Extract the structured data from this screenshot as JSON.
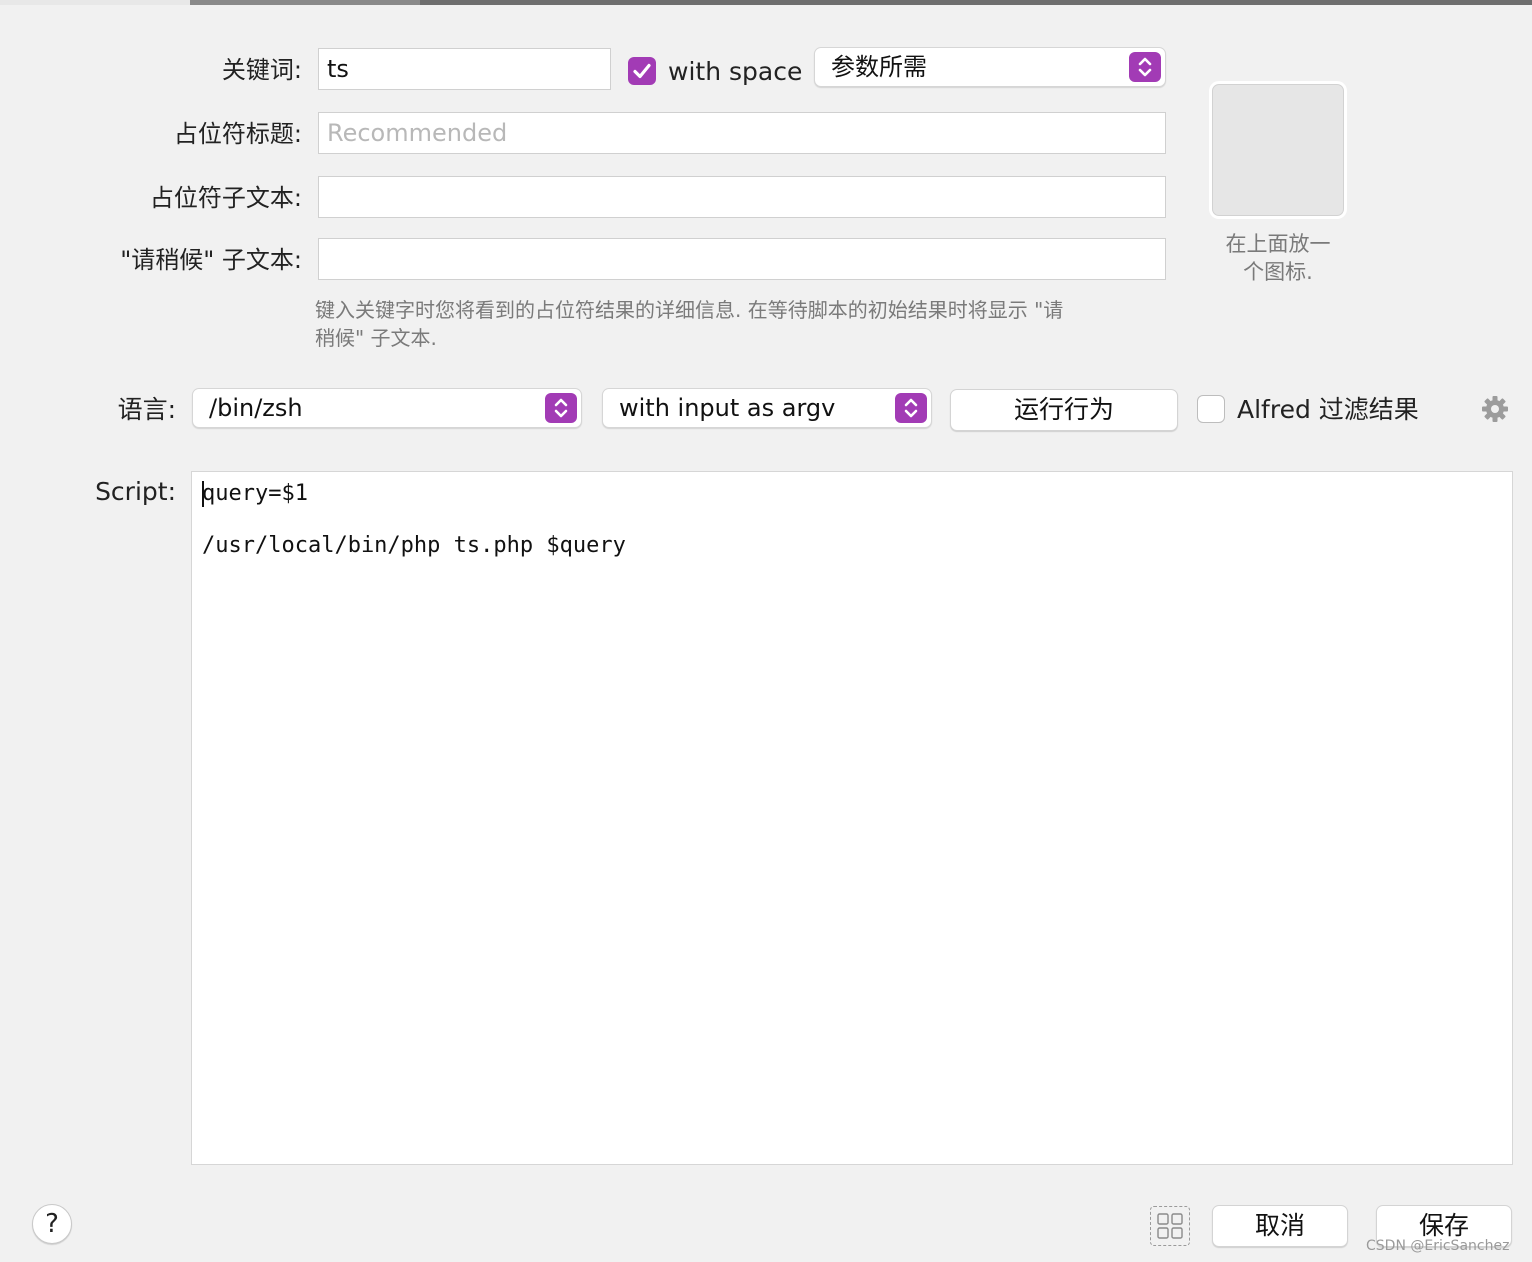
{
  "form": {
    "keyword_label": "关键词:",
    "keyword_value": "ts",
    "with_space_label": "with space",
    "with_space_checked": true,
    "argument_select_value": "参数所需",
    "placeholder_title_label": "占位符标题:",
    "placeholder_title_placeholder": "Recommended",
    "placeholder_subtext_label": "占位符子文本:",
    "placeholder_subtext_value": "",
    "wait_subtext_label": "\"请稍候\" 子文本:",
    "wait_subtext_value": "",
    "hint_text_line1": "键入关键字时您将看到的占位符结果的详细信息. 在等待脚本的初始结果时将显示 \"请",
    "hint_text_line2": "稍候\" 子文本.",
    "icon_hint_line1": "在上面放一",
    "icon_hint_line2": "个图标."
  },
  "language": {
    "label": "语言:",
    "shell_value": "/bin/zsh",
    "input_mode_value": "with input as argv",
    "run_behaviour_label": "运行行为",
    "alfred_filter_label": "Alfred 过滤结果",
    "alfred_filter_checked": false
  },
  "script": {
    "label": "Script:",
    "lines": [
      "query=$1",
      "",
      "/usr/local/bin/php ts.php $query"
    ]
  },
  "footer": {
    "help_label": "?",
    "cancel_label": "取消",
    "save_label": "保存",
    "watermark": "CSDN @EricSanchez"
  },
  "colors": {
    "accent": "#a23bb5",
    "background": "#f1f1f1"
  }
}
